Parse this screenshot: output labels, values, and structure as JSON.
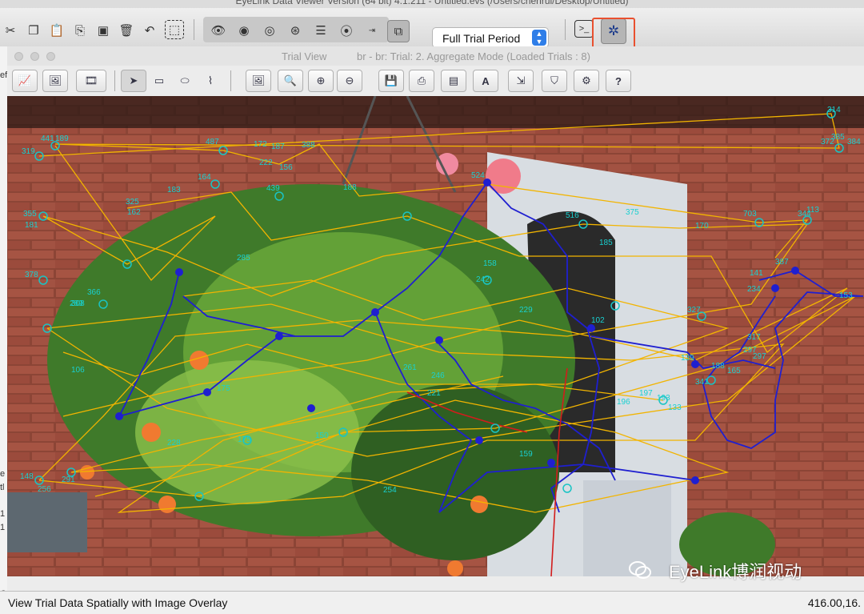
{
  "app": {
    "title": "EyeLink Data Viewer Version  (64 bit) 4.1.211 - Untitled.evs (/Users/chenrui/Desktop/Untitled)"
  },
  "main_toolbar": {
    "period_select": {
      "selected": "Full Trial Period"
    },
    "edit_icons": [
      "scissors-icon",
      "copy-icon",
      "paste-icon",
      "paste-special-icon",
      "export-icon",
      "delete-icon",
      "undo-icon",
      "select-all-icon"
    ],
    "view_icons": [
      "eye-fixation-icon",
      "eye-saccade-icon",
      "eye-blink-icon",
      "eye-sample-icon",
      "report-icon",
      "target-icon",
      "import-icon",
      "spatial-overlay-icon"
    ],
    "right_icons": [
      "console-icon",
      "image-overlay-mode-icon"
    ]
  },
  "left_panel": {
    "items": [
      "ef",
      "e",
      "tl",
      "1",
      "1",
      "O"
    ]
  },
  "trial_window": {
    "title": "Trial View",
    "subtitle": "br - br: Trial: 2. Aggregate Mode (Loaded Trials : 8)",
    "toolbar_icons": [
      "temporal-graph-icon",
      "spatial-overlay-icon",
      "animation-icon",
      "pointer-tool-icon",
      "rectangle-tool-icon",
      "ellipse-tool-icon",
      "freehand-tool-icon",
      "image-icon",
      "zoom-icon",
      "zoom-in-icon",
      "zoom-out-icon",
      "save-icon",
      "save-all-icon",
      "save-as-icon",
      "text-icon",
      "export-icon",
      "shield-icon",
      "settings-icon",
      "help-icon"
    ]
  },
  "overlay": {
    "fixation_labels": [
      "441",
      "189",
      "319",
      "487",
      "172",
      "187",
      "388",
      "222",
      "156",
      "164",
      "439",
      "188",
      "325",
      "162",
      "183",
      "355",
      "181",
      "378",
      "314",
      "385",
      "372",
      "384",
      "366",
      "308",
      "285",
      "524",
      "516",
      "375",
      "170",
      "113",
      "703",
      "344",
      "141",
      "234",
      "387",
      "153",
      "185",
      "327",
      "139",
      "102",
      "188",
      "165",
      "317",
      "297",
      "297",
      "341",
      "196",
      "289",
      "106",
      "175",
      "228",
      "148",
      "256",
      "291",
      "254",
      "159",
      "150",
      "197",
      "193",
      "133",
      "261",
      "246",
      "221",
      "158",
      "242",
      "229",
      "175"
    ],
    "watermark": "EyeLink博润视动",
    "colors": {
      "fixation": "#19c4c4",
      "saccade": "#f2b400",
      "path": "#1f1fd0",
      "sample": "#d21c1c"
    }
  },
  "status": {
    "left": "View Trial Data Spatially with Image Overlay",
    "right": "416.00,16."
  }
}
